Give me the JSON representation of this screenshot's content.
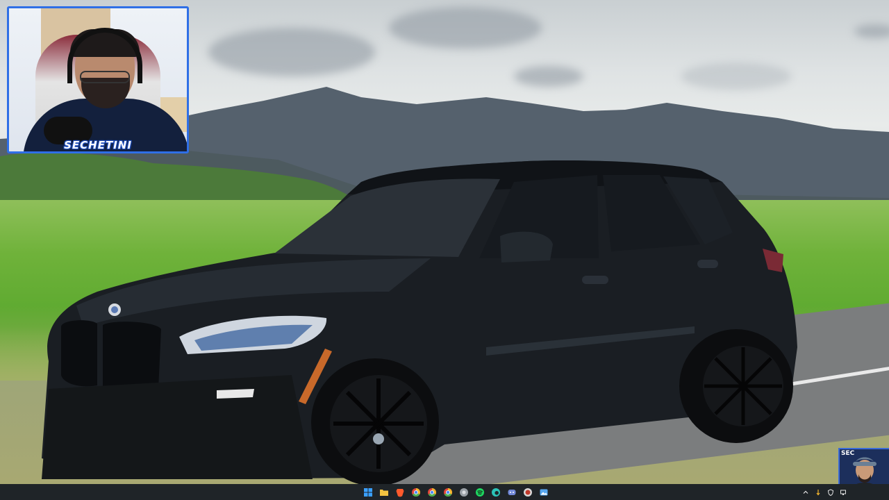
{
  "webcam": {
    "name_label": "SECHETINI"
  },
  "corner_avatar": {
    "tag": "SEC"
  },
  "taskbar": {
    "pinned": [
      {
        "name": "windows-start-icon",
        "color": "#3aa0ff"
      },
      {
        "name": "file-explorer-icon",
        "color": "#f3c341"
      },
      {
        "name": "brave-browser-icon",
        "color": "#ff5a2c"
      },
      {
        "name": "chrome-icon",
        "color": "#4caf50"
      },
      {
        "name": "chrome-profile-icon",
        "color": "#e0463b"
      },
      {
        "name": "chrome-alt-profile-icon",
        "color": "#f1b42f"
      },
      {
        "name": "chrome-dev-icon",
        "color": "#9aa0a6"
      },
      {
        "name": "spotify-icon",
        "color": "#1ed760"
      },
      {
        "name": "edge-icon",
        "color": "#2bc3b8"
      },
      {
        "name": "discord-icon",
        "color": "#7289da"
      },
      {
        "name": "obs-icon",
        "color": "#d8d8d8"
      },
      {
        "name": "photos-icon",
        "color": "#57a7f0"
      }
    ],
    "tray": [
      {
        "name": "show-hidden-icons-chevron-icon",
        "glyph": "^"
      },
      {
        "name": "usb-device-icon",
        "glyph": "⇩"
      },
      {
        "name": "shield-icon",
        "glyph": "⛉"
      },
      {
        "name": "network-icon",
        "glyph": "▭"
      }
    ]
  },
  "colors": {
    "webcam_border": "#2f6fe6",
    "taskbar_bg": "#1f2428"
  }
}
